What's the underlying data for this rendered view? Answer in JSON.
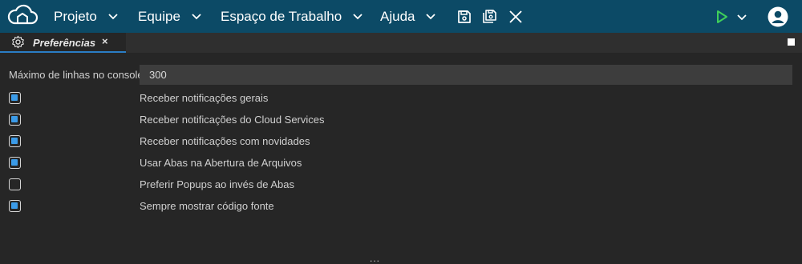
{
  "menubar": {
    "menus": [
      {
        "label": "Projeto"
      },
      {
        "label": "Equipe"
      },
      {
        "label": "Espaço de Trabalho"
      },
      {
        "label": "Ajuda"
      }
    ],
    "tools": [
      "save-icon",
      "save-all-icon",
      "close-icon"
    ],
    "run_icon": "play-icon",
    "run_color": "#3fcf5a"
  },
  "tabs": [
    {
      "label": "Preferências",
      "close": "×",
      "icon": "gear-icon"
    }
  ],
  "preferences": {
    "max_lines_label": "Máximo de linhas no console",
    "max_lines_value": "300",
    "options": [
      {
        "label": "Receber notificações gerais",
        "checked": true
      },
      {
        "label": "Receber notificações do Cloud Services",
        "checked": true
      },
      {
        "label": "Receber notificações com novidades",
        "checked": true
      },
      {
        "label": "Usar Abas na Abertura de Arquivos",
        "checked": true
      },
      {
        "label": "Preferir Popups ao invés de Abas",
        "checked": false
      },
      {
        "label": "Sempre mostrar código fonte",
        "checked": true
      }
    ]
  },
  "footer": {
    "grip": "..."
  },
  "colors": {
    "menubar": "#0c4a66",
    "accent": "#2a7dc5",
    "checkbox": "#3b9be8",
    "background": "#262626"
  }
}
